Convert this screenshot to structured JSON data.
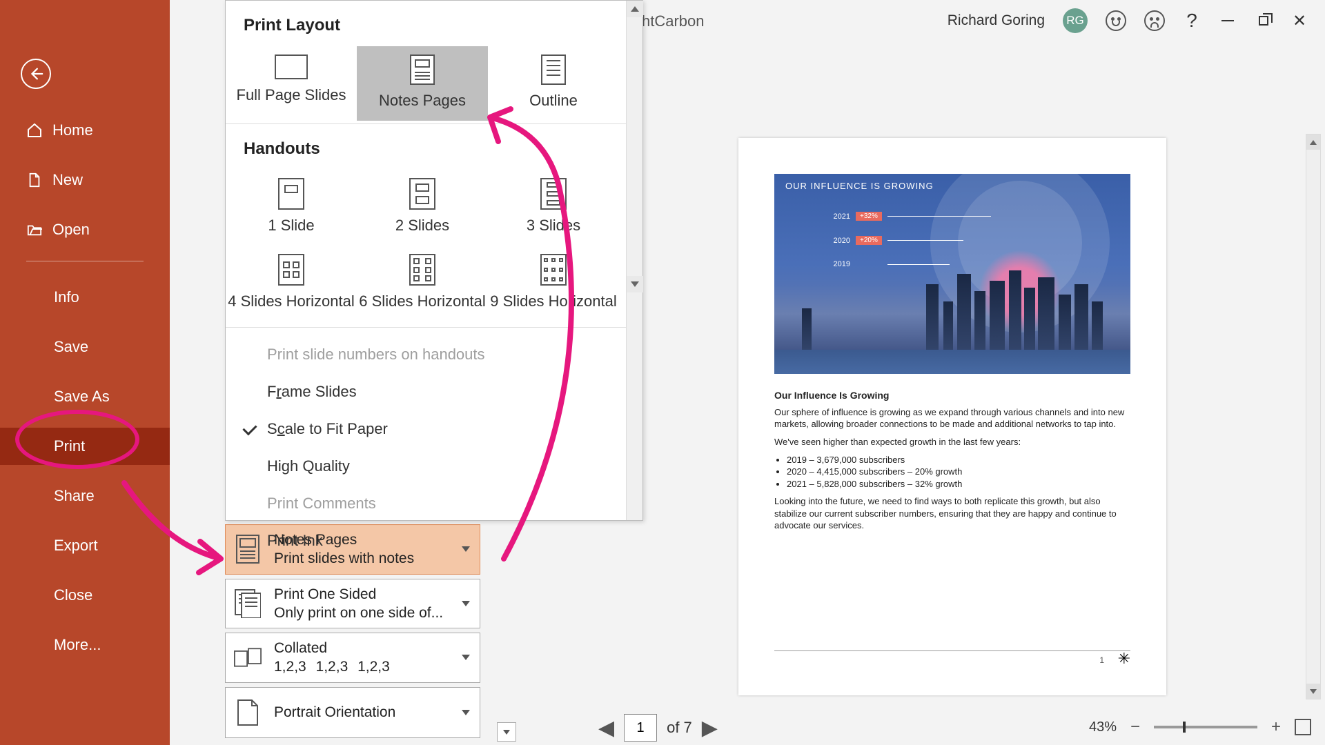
{
  "titlebar": {
    "doc_partial": "htCarbon",
    "user_name": "Richard Goring",
    "user_initials": "RG"
  },
  "sidebar": {
    "home": "Home",
    "new": "New",
    "open": "Open",
    "info": "Info",
    "save": "Save",
    "save_as": "Save As",
    "print": "Print",
    "share": "Share",
    "export": "Export",
    "close": "Close",
    "more": "More..."
  },
  "dropdown": {
    "section_layout": "Print Layout",
    "full_page": "Full Page Slides",
    "notes_pages": "Notes Pages",
    "outline": "Outline",
    "section_handouts": "Handouts",
    "h1": "1 Slide",
    "h2": "2 Slides",
    "h3": "3 Slides",
    "h4": "4 Slides Horizontal",
    "h6": "6 Slides Horizontal",
    "h9": "9 Slides Horizontal",
    "opt_numbers": "Print slide numbers on handouts",
    "opt_frame_pre": "F",
    "opt_frame_und": "r",
    "opt_frame_post": "ame Slides",
    "opt_scale_pre": "S",
    "opt_scale_und": "c",
    "opt_scale_post": "ale to Fit Paper",
    "opt_hq": "High Quality",
    "opt_comments": "Print Comments",
    "opt_ink": "Print Ink"
  },
  "print_settings": {
    "layout_title": "Notes Pages",
    "layout_sub": "Print slides with notes",
    "sided_title": "Print One Sided",
    "sided_sub": "Only print on one side of...",
    "collated_title": "Collated",
    "collated_sub": "1,2,3    1,2,3    1,2,3",
    "orient_title": "Portrait Orientation"
  },
  "preview": {
    "slide_title": "OUR INFLUENCE IS GROWING",
    "bars": [
      {
        "year": "2021",
        "pct": "+32%",
        "len": 150
      },
      {
        "year": "2020",
        "pct": "+20%",
        "len": 110
      },
      {
        "year": "2019",
        "pct": "",
        "len": 90
      }
    ],
    "notes_title": "Our Influence Is Growing",
    "p1": "Our sphere of influence is growing as we expand through various channels and into new markets, allowing broader connections to be made and additional networks to tap into.",
    "p2": "We've seen higher than expected growth in the last few years:",
    "b1": "2019 – 3,679,000 subscribers",
    "b2": "2020 – 4,415,000 subscribers – 20% growth",
    "b3": "2021 – 5,828,000 subscribers – 32% growth",
    "p3": "Looking into the future, we need to find ways to both replicate this growth, but also stabilize our current subscriber numbers, ensuring that they are happy and continue to advocate our services.",
    "page_number": "1"
  },
  "nav": {
    "current": "1",
    "of": " of 7"
  },
  "zoom": {
    "pct": "43%"
  }
}
